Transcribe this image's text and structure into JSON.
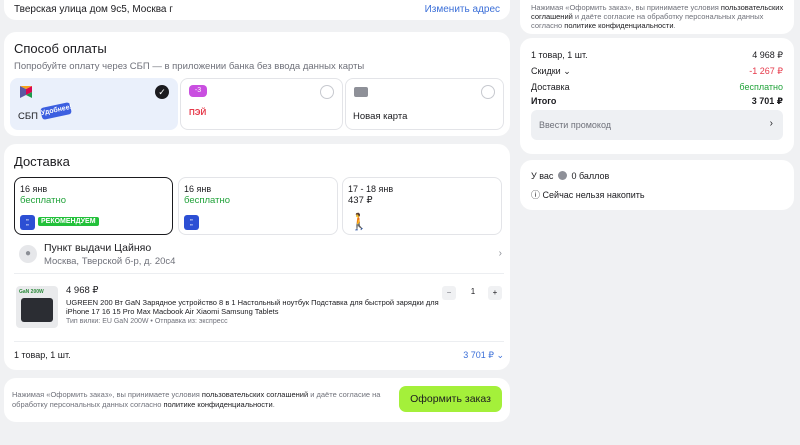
{
  "address": {
    "text": "Тверская улица дом 9с5, Москва г",
    "change": "Изменить адрес"
  },
  "payment": {
    "title": "Способ оплаты",
    "subtitle": "Попробуйте оплату через СБП — в приложении банка без ввода данных карты",
    "options": [
      {
        "label": "СБП",
        "badge": "Удобнее!",
        "selected": true
      },
      {
        "label": "",
        "badge": "-3",
        "brand": "ПЭЙ",
        "selected": false
      },
      {
        "label": "Новая карта",
        "selected": false
      }
    ]
  },
  "delivery": {
    "title": "Доставка",
    "options": [
      {
        "date": "16 янв",
        "price": "бесплатно",
        "tag": "РЕКОМЕНДУЕМ"
      },
      {
        "date": "16 янв",
        "price": "бесплатно"
      },
      {
        "date": "17 - 18 янв",
        "price": "437 ₽"
      }
    ],
    "pickup": {
      "title": "Пункт выдачи Цайняо",
      "address": "Москва, Тверской б-р, д. 20с4"
    },
    "item": {
      "thumb_label": "GaN 200W",
      "price": "4 968 ₽",
      "name": "UGREEN 200 Вт GaN Зарядное устройство 8 в 1 Настольный ноутбук Подставка для быстрой зарядки для iPhone 17 16 15 Pro Max Macbook Air Xiaomi Samsung Tablets",
      "meta": "Тип вилки: EU GaN 200W • Отправка из: экспресс",
      "qty": "1"
    },
    "footer": {
      "count": "1 товар, 1 шт.",
      "total": "3 701 ₽"
    }
  },
  "order_bar": {
    "terms_a": "Нажимая «Оформить заказ», вы принимаете условия ",
    "terms_link1": "пользовательских соглашений",
    "terms_b": " и даёте согласие на обработку персональных данных согласно ",
    "terms_link2": "политике конфиденциальности",
    "terms_c": ".",
    "button": "Оформить заказ"
  },
  "summary": {
    "rows": [
      {
        "k": "1 товар, 1 шт.",
        "v": "4 968 ₽"
      },
      {
        "k": "Скидки",
        "v": "-1 267 ₽"
      },
      {
        "k": "Доставка",
        "v": "бесплатно"
      },
      {
        "k": "Итого",
        "v": "3 701 ₽"
      }
    ],
    "promo_placeholder": "Ввести промокод"
  },
  "bonus": {
    "line1_a": "У вас",
    "line1_b": "0 баллов",
    "line2": "Сейчас нельзя накопить"
  },
  "colors": {
    "accent": "#a4f03a",
    "link": "#3b6fd8",
    "green": "#22a33b",
    "red": "#e6394a"
  }
}
